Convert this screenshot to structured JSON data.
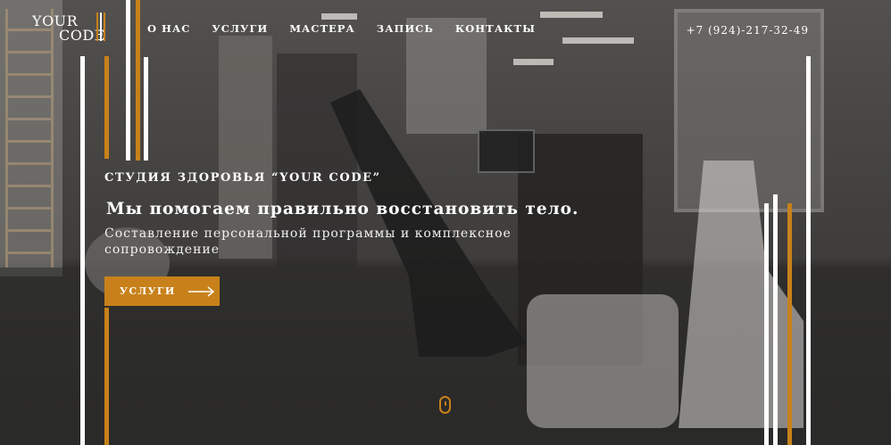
{
  "header": {
    "logo": {
      "line1": "YOUR",
      "line2": "CODE"
    },
    "nav": [
      {
        "label": "О НАС"
      },
      {
        "label": "УСЛУГИ"
      },
      {
        "label": "МАСТЕРА"
      },
      {
        "label": "ЗАПИСЬ"
      },
      {
        "label": "КОНТАКТЫ"
      }
    ],
    "phone": "+7 (924)-217-32-49"
  },
  "hero": {
    "eyebrow": "СТУДИЯ ЗДОРОВЬЯ “YOUR CODE”",
    "headline": "Мы помогаем правильно восстановить тело.",
    "subtext": "Составление персональной программы и комплексное сопровождение",
    "cta_label": "УСЛУГИ"
  },
  "colors": {
    "accent": "#c8811a",
    "text": "#ffffff"
  },
  "icons": {
    "cta_arrow": "arrow-right-icon",
    "scroll": "mouse-scroll-icon"
  }
}
